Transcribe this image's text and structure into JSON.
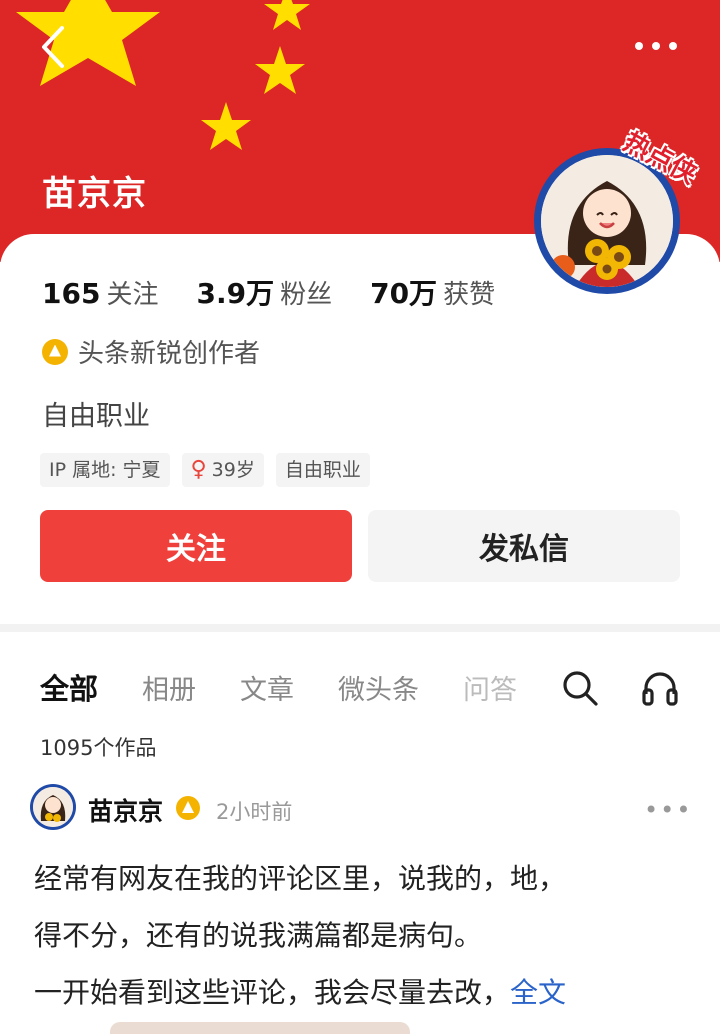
{
  "profile": {
    "name": "苗京京",
    "badge_text": "热点侠",
    "stats": [
      {
        "num": "165",
        "label": "关注"
      },
      {
        "num": "3.9万",
        "label": "粉丝"
      },
      {
        "num": "70万",
        "label": "获赞"
      }
    ],
    "creator_label": "头条新锐创作者",
    "bio": "自由职业",
    "tags": {
      "ip": "IP 属地: 宁夏",
      "gender_symbol": "♀",
      "age": "39岁",
      "job": "自由职业"
    },
    "follow_label": "关注",
    "message_label": "发私信"
  },
  "tabs": [
    {
      "label": "全部"
    },
    {
      "label": "相册"
    },
    {
      "label": "文章"
    },
    {
      "label": "微头条"
    },
    {
      "label": "问答"
    }
  ],
  "works_count": "1095个作品",
  "post": {
    "author": "苗京京",
    "time": "2小时前",
    "more": "•••",
    "lines": [
      "经常有网友在我的评论区里，说我的，地，",
      "得不分，还有的说我满篇都是病句。",
      "一开始看到这些评论，我会尽量去改，"
    ],
    "full_text_link": "全文"
  },
  "colors": {
    "banner_red": "#dd2626",
    "star_yellow": "#ffde00",
    "follow_button": "#f0403c",
    "link_blue": "#2a63c9",
    "badge_gold": "#f5b301"
  },
  "icons": [
    "back-arrow-icon",
    "more-dots-icon",
    "search-icon",
    "headphones-icon",
    "creator-badge-icon",
    "verified-icon",
    "female-icon"
  ]
}
